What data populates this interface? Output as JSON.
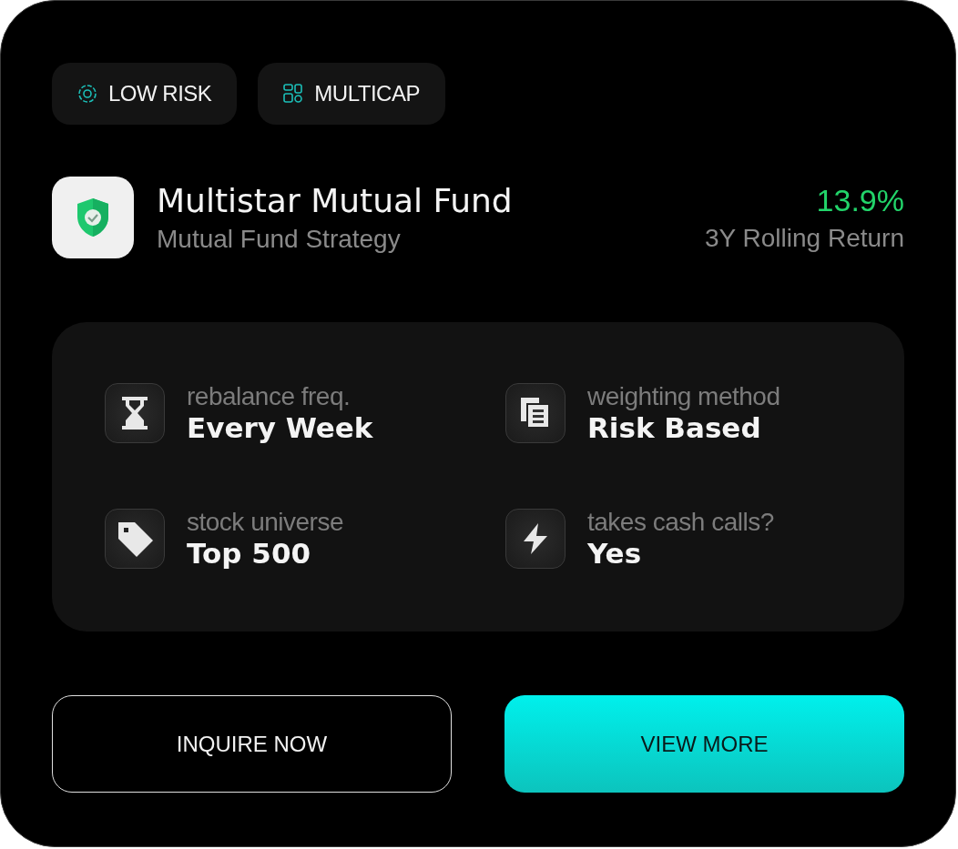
{
  "tags": [
    {
      "kind": "risk",
      "label": "LOW RISK"
    },
    {
      "kind": "cap",
      "label": "MULTICAP"
    }
  ],
  "fund": {
    "name": "Multistar Mutual Fund",
    "subtitle": "Mutual Fund Strategy",
    "return_value": "13.9%",
    "return_label": "3Y Rolling Return"
  },
  "stats": [
    {
      "kind": "hourglass",
      "label": "rebalance freq.",
      "value": "Every Week"
    },
    {
      "kind": "documents",
      "label": "weighting method",
      "value": "Risk Based"
    },
    {
      "kind": "tag",
      "label": "stock universe",
      "value": "Top 500"
    },
    {
      "kind": "bolt",
      "label": "takes cash calls?",
      "value": "Yes"
    }
  ],
  "buttons": [
    {
      "kind": "outline",
      "label": "INQUIRE NOW"
    },
    {
      "kind": "filled",
      "label": "VIEW MORE"
    }
  ]
}
